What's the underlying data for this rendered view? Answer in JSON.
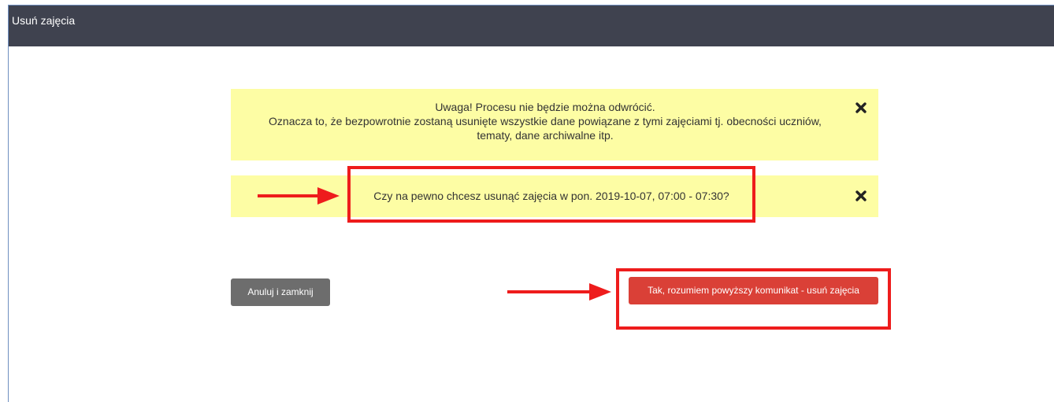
{
  "dialog": {
    "title": "Usuń zajęcia"
  },
  "warning_alert": {
    "line1": "Uwaga! Procesu nie będzie można odwrócić.",
    "line2": "Oznacza to, że bezpowrotnie zostaną usunięte wszystkie dane powiązane z tymi zajęciami tj. obecności uczniów, tematy, dane archiwalne itp.",
    "close_icon": "close-icon"
  },
  "confirm_alert": {
    "text": "Czy na pewno chcesz usunąć zajęcia w pon. 2019-10-07, 07:00 - 07:30?",
    "close_icon": "close-icon"
  },
  "buttons": {
    "cancel_label": "Anuluj i zamknij",
    "delete_label": "Tak, rozumiem powyższy komunikat - usuń zajęcia"
  },
  "annotations": {
    "color": "#ee1c1c"
  },
  "colors": {
    "header_bg": "#3f424f",
    "alert_bg": "#fdfda4",
    "cancel_bg": "#6d6d6d",
    "delete_bg": "#da4037"
  }
}
